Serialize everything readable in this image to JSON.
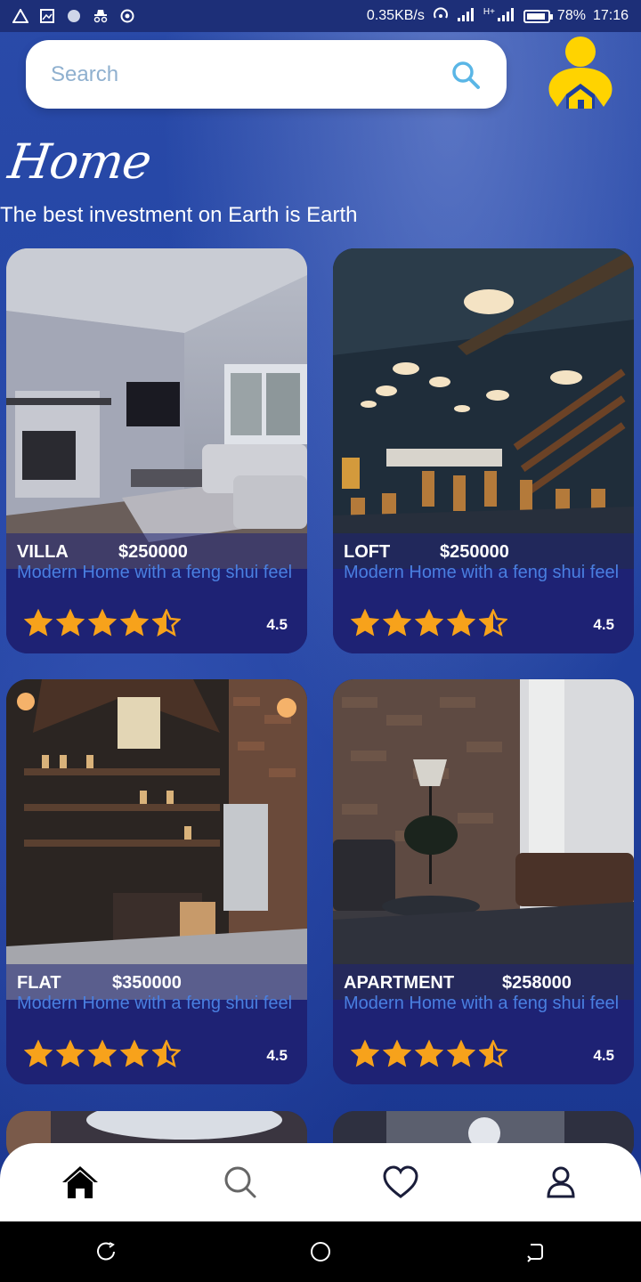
{
  "status_bar": {
    "net_speed": "0.35KB/s",
    "battery": "78%",
    "time": "17:16",
    "network": "H+"
  },
  "search": {
    "placeholder": "Search"
  },
  "header": {
    "title": "Home",
    "tagline": "The best investment on Earth is Earth"
  },
  "listings": [
    {
      "type": "VILLA",
      "price": "$250000",
      "desc": "Modern Home with a feng shui feel",
      "rating_text": "4.5",
      "rating": 4.5
    },
    {
      "type": "LOFT",
      "price": "$250000",
      "desc": "Modern Home with a feng shui feel",
      "rating_text": "4.5",
      "rating": 4.5
    },
    {
      "type": "FLAT",
      "price": "$350000",
      "desc": "Modern Home with a feng shui feel",
      "rating_text": "4.5",
      "rating": 4.5
    },
    {
      "type": "APARTMENT",
      "price": "$258000",
      "desc": "Modern Home with a feng shui feel",
      "rating_text": "4.5",
      "rating": 4.5
    }
  ],
  "nav": {
    "items": [
      {
        "icon": "home-icon",
        "active": true
      },
      {
        "icon": "search-icon",
        "active": false
      },
      {
        "icon": "heart-icon",
        "active": false
      },
      {
        "icon": "user-icon",
        "active": false
      }
    ]
  },
  "colors": {
    "star": "#f7a21b",
    "accent_desc": "#4a7fe0",
    "logo": "#ffd300"
  }
}
